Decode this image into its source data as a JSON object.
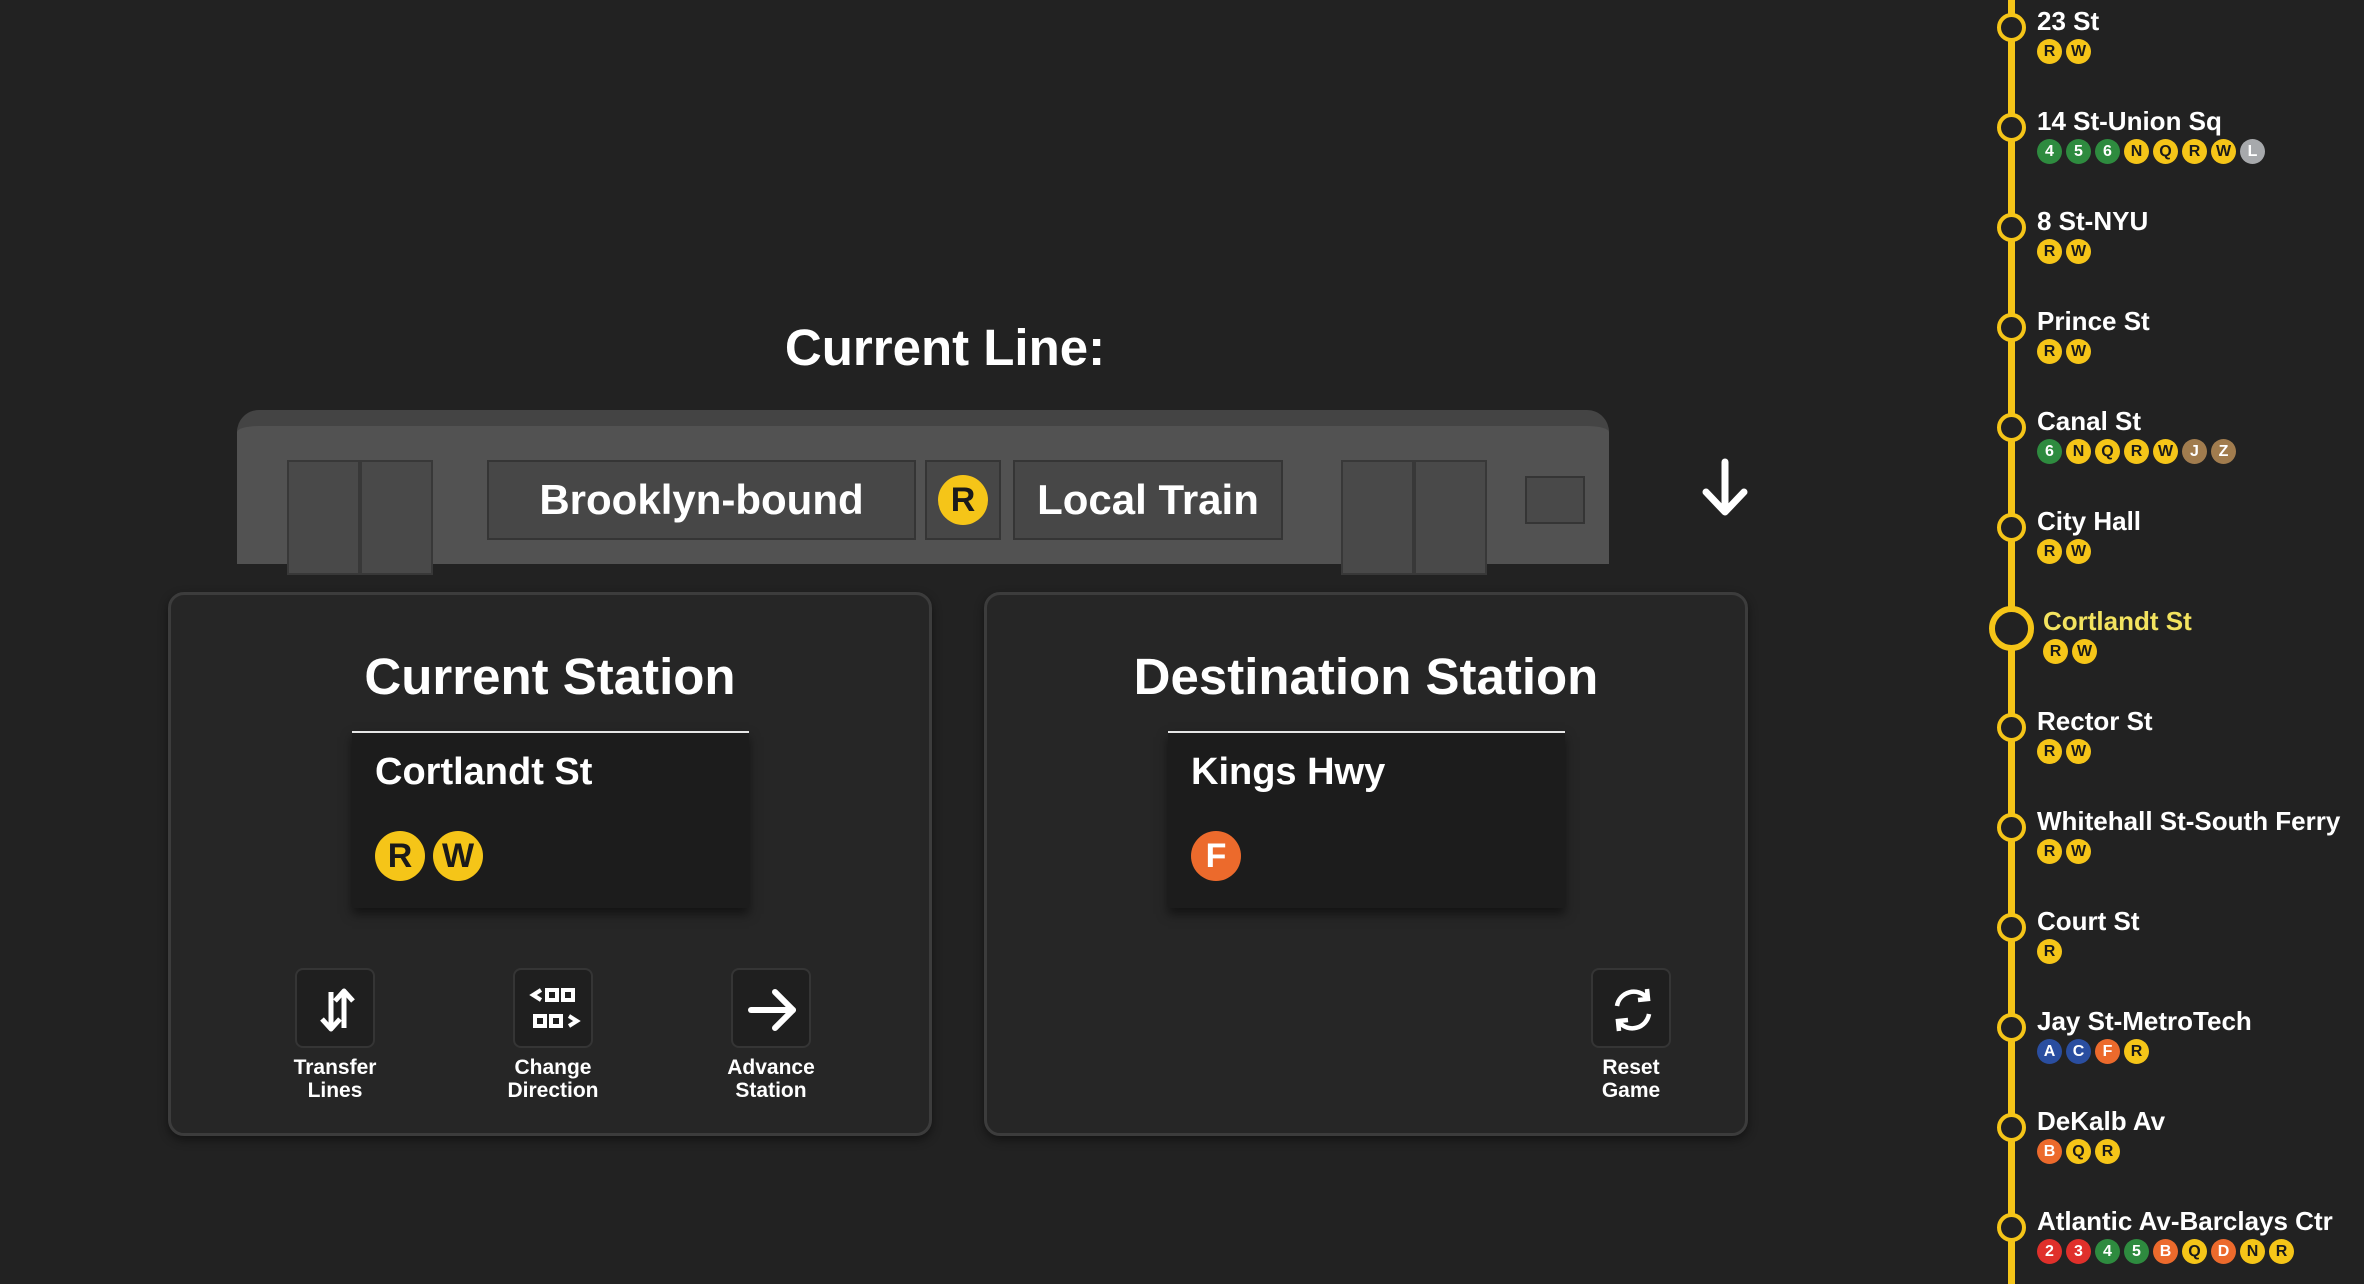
{
  "colors": {
    "background": "#222222",
    "nqrw_yellow": "#f5c518",
    "lex_green": "#2e8b3f",
    "ace_blue": "#2a4ea0",
    "bdfm_orange": "#ec6a2c",
    "l_gray": "#a7a9ac",
    "jz_brown": "#a17c4e",
    "red_123": "#e0302b",
    "current_stop_text": "#f3e35f"
  },
  "heading": {
    "current_line_label": "Current Line:"
  },
  "train": {
    "direction": "Brooklyn-bound",
    "line": {
      "label": "R",
      "color": "#f5c518",
      "dark_text": true
    },
    "service": "Local Train",
    "direction_icon": "arrow-down-icon"
  },
  "current_panel": {
    "title": "Current Station",
    "station_name": "Cortlandt St",
    "lines": [
      {
        "label": "R",
        "color": "#f5c518",
        "dark_text": true
      },
      {
        "label": "W",
        "color": "#f5c518",
        "dark_text": true
      }
    ],
    "actions": [
      {
        "label1": "Transfer",
        "label2": "Lines",
        "icon": "transfer-icon"
      },
      {
        "label1": "Change",
        "label2": "Direction",
        "icon": "change-direction-icon"
      },
      {
        "label1": "Advance",
        "label2": "Station",
        "icon": "arrow-right-icon"
      }
    ]
  },
  "destination_panel": {
    "title": "Destination Station",
    "station_name": "Kings Hwy",
    "lines": [
      {
        "label": "F",
        "color": "#ec6a2c",
        "dark_text": false
      }
    ],
    "reset": {
      "label1": "Reset",
      "label2": "Game",
      "icon": "reset-icon"
    }
  },
  "route": {
    "current_index": 6,
    "stops": [
      {
        "name": "23 St",
        "lines": [
          [
            "R",
            "#f5c518",
            1
          ],
          [
            "W",
            "#f5c518",
            1
          ]
        ]
      },
      {
        "name": "14 St-Union Sq",
        "lines": [
          [
            "4",
            "#2e8b3f",
            0
          ],
          [
            "5",
            "#2e8b3f",
            0
          ],
          [
            "6",
            "#2e8b3f",
            0
          ],
          [
            "N",
            "#f5c518",
            1
          ],
          [
            "Q",
            "#f5c518",
            1
          ],
          [
            "R",
            "#f5c518",
            1
          ],
          [
            "W",
            "#f5c518",
            1
          ],
          [
            "L",
            "#a7a9ac",
            0
          ]
        ]
      },
      {
        "name": "8 St-NYU",
        "lines": [
          [
            "R",
            "#f5c518",
            1
          ],
          [
            "W",
            "#f5c518",
            1
          ]
        ]
      },
      {
        "name": "Prince St",
        "lines": [
          [
            "R",
            "#f5c518",
            1
          ],
          [
            "W",
            "#f5c518",
            1
          ]
        ]
      },
      {
        "name": "Canal St",
        "lines": [
          [
            "6",
            "#2e8b3f",
            0
          ],
          [
            "N",
            "#f5c518",
            1
          ],
          [
            "Q",
            "#f5c518",
            1
          ],
          [
            "R",
            "#f5c518",
            1
          ],
          [
            "W",
            "#f5c518",
            1
          ],
          [
            "J",
            "#a17c4e",
            0
          ],
          [
            "Z",
            "#a17c4e",
            0
          ]
        ]
      },
      {
        "name": "City Hall",
        "lines": [
          [
            "R",
            "#f5c518",
            1
          ],
          [
            "W",
            "#f5c518",
            1
          ]
        ]
      },
      {
        "name": "Cortlandt St",
        "lines": [
          [
            "R",
            "#f5c518",
            1
          ],
          [
            "W",
            "#f5c518",
            1
          ]
        ]
      },
      {
        "name": "Rector St",
        "lines": [
          [
            "R",
            "#f5c518",
            1
          ],
          [
            "W",
            "#f5c518",
            1
          ]
        ]
      },
      {
        "name": "Whitehall St-South Ferry",
        "lines": [
          [
            "R",
            "#f5c518",
            1
          ],
          [
            "W",
            "#f5c518",
            1
          ]
        ]
      },
      {
        "name": "Court St",
        "lines": [
          [
            "R",
            "#f5c518",
            1
          ]
        ]
      },
      {
        "name": "Jay St-MetroTech",
        "lines": [
          [
            "A",
            "#2a4ea0",
            0
          ],
          [
            "C",
            "#2a4ea0",
            0
          ],
          [
            "F",
            "#ec6a2c",
            0
          ],
          [
            "R",
            "#f5c518",
            1
          ]
        ]
      },
      {
        "name": "DeKalb Av",
        "lines": [
          [
            "B",
            "#ec6a2c",
            0
          ],
          [
            "Q",
            "#f5c518",
            1
          ],
          [
            "R",
            "#f5c518",
            1
          ]
        ]
      },
      {
        "name": "Atlantic Av-Barclays Ctr",
        "lines": [
          [
            "2",
            "#e0302b",
            0
          ],
          [
            "3",
            "#e0302b",
            0
          ],
          [
            "4",
            "#2e8b3f",
            0
          ],
          [
            "5",
            "#2e8b3f",
            0
          ],
          [
            "B",
            "#ec6a2c",
            0
          ],
          [
            "Q",
            "#f5c518",
            1
          ],
          [
            "D",
            "#ec6a2c",
            0
          ],
          [
            "N",
            "#f5c518",
            1
          ],
          [
            "R",
            "#f5c518",
            1
          ]
        ]
      }
    ]
  }
}
